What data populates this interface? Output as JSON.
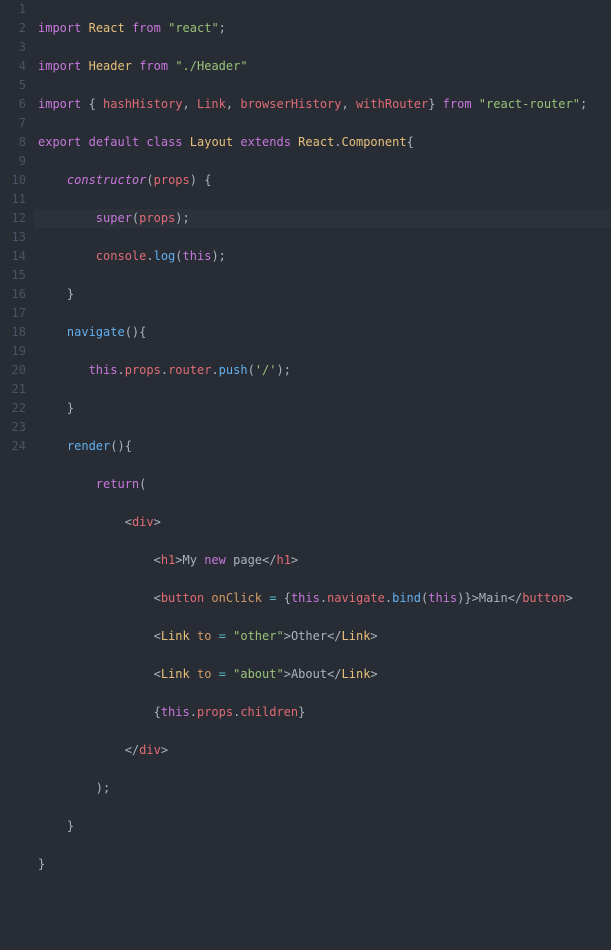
{
  "chart_data": null,
  "highlighted_line": 6,
  "lines": {
    "1": {
      "num": "1"
    },
    "2": {
      "num": "2"
    },
    "3": {
      "num": "3"
    },
    "4": {
      "num": "4"
    },
    "5": {
      "num": "5"
    },
    "6": {
      "num": "6"
    },
    "7": {
      "num": "7"
    },
    "8": {
      "num": "8"
    },
    "9": {
      "num": "9"
    },
    "10": {
      "num": "10"
    },
    "11": {
      "num": "11"
    },
    "12": {
      "num": "12"
    },
    "13": {
      "num": "13"
    },
    "14": {
      "num": "14"
    },
    "15": {
      "num": "15"
    },
    "16": {
      "num": "16"
    },
    "17": {
      "num": "17"
    },
    "18": {
      "num": "18"
    },
    "19": {
      "num": "19"
    },
    "20": {
      "num": "20"
    },
    "21": {
      "num": "21"
    },
    "22": {
      "num": "22"
    },
    "23": {
      "num": "23"
    },
    "24": {
      "num": "24"
    }
  },
  "tokens": {
    "import": "import",
    "from": "from",
    "export": "export",
    "default": "default",
    "class": "class",
    "extends": "extends",
    "constructor": "constructor",
    "super": "super",
    "this": "this",
    "return": "return",
    "new_kw": "new",
    "React": "React",
    "Header": "Header",
    "Layout": "Layout",
    "Component": "Component",
    "hashHistory": "hashHistory",
    "Link": "Link",
    "browserHistory": "browserHistory",
    "withRouter": "withRouter",
    "props": "props",
    "router": "router",
    "children": "children",
    "console": "console",
    "log": "log",
    "navigate": "navigate",
    "render": "render",
    "push": "push",
    "bind": "bind",
    "str_react": "\"react\"",
    "str_header": "\"./Header\"",
    "str_react_router": "\"react-router\"",
    "str_slash": "'/'",
    "str_other": "\"other\"",
    "str_about": "\"about\"",
    "txt_my": "My ",
    "txt_page": " page",
    "txt_main": "Main",
    "txt_other": "Other",
    "txt_about": "About",
    "tag_div": "div",
    "tag_h1": "h1",
    "tag_button": "button",
    "tag_link": "Link",
    "attr_onClick": "onClick",
    "attr_to": "to"
  }
}
